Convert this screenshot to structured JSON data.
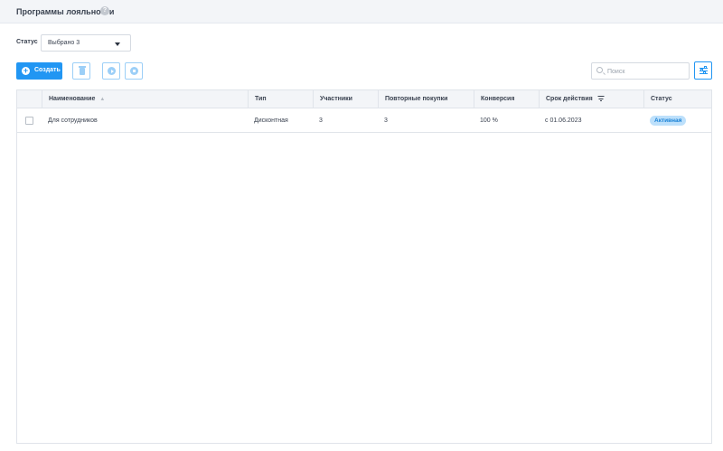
{
  "header": {
    "title": "Программы лояльности",
    "help_icon": "question-circle-icon"
  },
  "filters": {
    "status_label": "Статус",
    "status_value": "Выбрано 3"
  },
  "toolbar": {
    "create_label": "Создать",
    "delete_icon": "trash-icon",
    "activate_icon": "play-circle-icon",
    "deactivate_icon": "stop-circle-icon",
    "search_placeholder": "Поиск",
    "columns_settings_icon": "sliders-icon",
    "accent_color": "#2196f3"
  },
  "table": {
    "columns": [
      {
        "label": "Наименование",
        "icon": "sort-icon"
      },
      {
        "label": "Тип"
      },
      {
        "label": "Участники"
      },
      {
        "label": "Повторные покупки"
      },
      {
        "label": "Конверсия"
      },
      {
        "label": "Срок действия",
        "icon": "filter-icon"
      },
      {
        "label": "Статус"
      }
    ],
    "rows": [
      {
        "name": "Для сотрудников",
        "type": "Дисконтная",
        "participants": "3",
        "repeat_purchases": "3",
        "conversion": "100 %",
        "validity": "с 01.06.2023",
        "status": "Активная",
        "status_color": "#bde0fb"
      }
    ]
  }
}
